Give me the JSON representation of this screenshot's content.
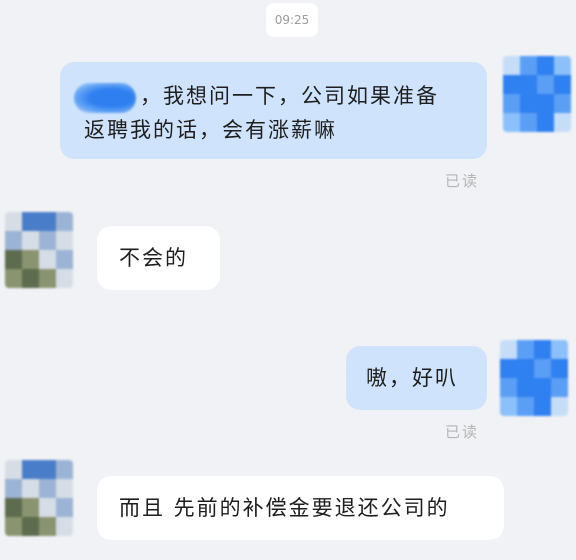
{
  "timestamp": "09:25",
  "messages": [
    {
      "direction": "out",
      "redacted_prefix": true,
      "lines": [
        "，我想问一下，公司如果准备",
        "返聘我的话，会有涨薪嘛"
      ]
    },
    {
      "direction": "in",
      "text": "不会的"
    },
    {
      "direction": "out",
      "text": "嗷，好叭"
    },
    {
      "direction": "in",
      "text": "而且 先前的补偿金要退还公司的"
    }
  ],
  "read_receipt": "已读",
  "colors": {
    "page_background": "#f1f2f5",
    "outgoing_bubble": "#cfe4fc",
    "incoming_bubble": "#ffffff",
    "read_receipt": "#b5b5b5",
    "timestamp_text": "#9b9b9b"
  },
  "avatars": {
    "me": {
      "state": "pixelated",
      "palette": [
        "#2f80f0",
        "#5a9ff5",
        "#8cc0fa",
        "#c6ddf8"
      ]
    },
    "other": {
      "state": "pixelated",
      "palette": [
        "#4a7dc9",
        "#9bb4d6",
        "#5d6b4f",
        "#8a9470",
        "#d7dde6"
      ]
    }
  }
}
